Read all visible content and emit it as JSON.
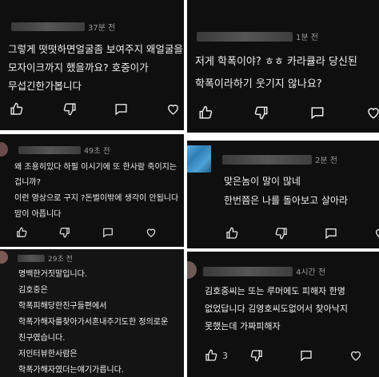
{
  "comments": [
    {
      "time": "37분 전",
      "lines": [
        "그렇게 떳떳하면얼굴좀 보여주지 왜얼굴을",
        "모자이크까지 했을까요? 호중이가",
        "무섭긴한가봅니다"
      ],
      "like_count": ""
    },
    {
      "time": "49초 전",
      "lines": [
        "왜 조용히있다 하필 이시기에 또 한사람 죽이지는",
        "겁니까?",
        "이런 영상으로 구지 ?돈벌이밖에 생각이 안됩니다",
        "맘이 아픕니다"
      ],
      "like_count": ""
    },
    {
      "time": "29초 전",
      "lines": [
        "명백한거짓말입니다.",
        "김호중은",
        "학폭피해당한친구들편에서",
        "학폭가해자를찾아가서혼내주기도한 정의로운",
        "친구였습니다.",
        "저인터뷰한사람은",
        "학폭가해자였더는얘기가릅니다."
      ],
      "like_count": ""
    },
    {
      "time": "1분 전",
      "lines": [
        "저게 학폭이야? ㅎㅎ 카라큘라 당신된",
        "학폭이라하기 웃기지 않나요?"
      ],
      "like_count": ""
    },
    {
      "time": "2분 전",
      "lines": [
        "맞은놈이 말이 많네",
        "한번쯤은 나를 돌아보고 살아라"
      ],
      "like_count": ""
    },
    {
      "time": "4시간 전",
      "lines": [
        "김호중씨는 또는 루머에도 피해자 한명",
        "없었답니다 김영호씨도없어서 찾아낙지",
        "못했는데 가짜피해자"
      ],
      "like_count": "3"
    }
  ],
  "icons": {
    "like": "thumbs-up-icon",
    "dislike": "thumbs-down-icon",
    "comment": "comment-icon",
    "heart": "heart-icon"
  },
  "colors": {
    "background": "#0f0f0f",
    "text": "#f0f0f0",
    "meta": "#9a9a9a",
    "divider": "#ffffff"
  }
}
